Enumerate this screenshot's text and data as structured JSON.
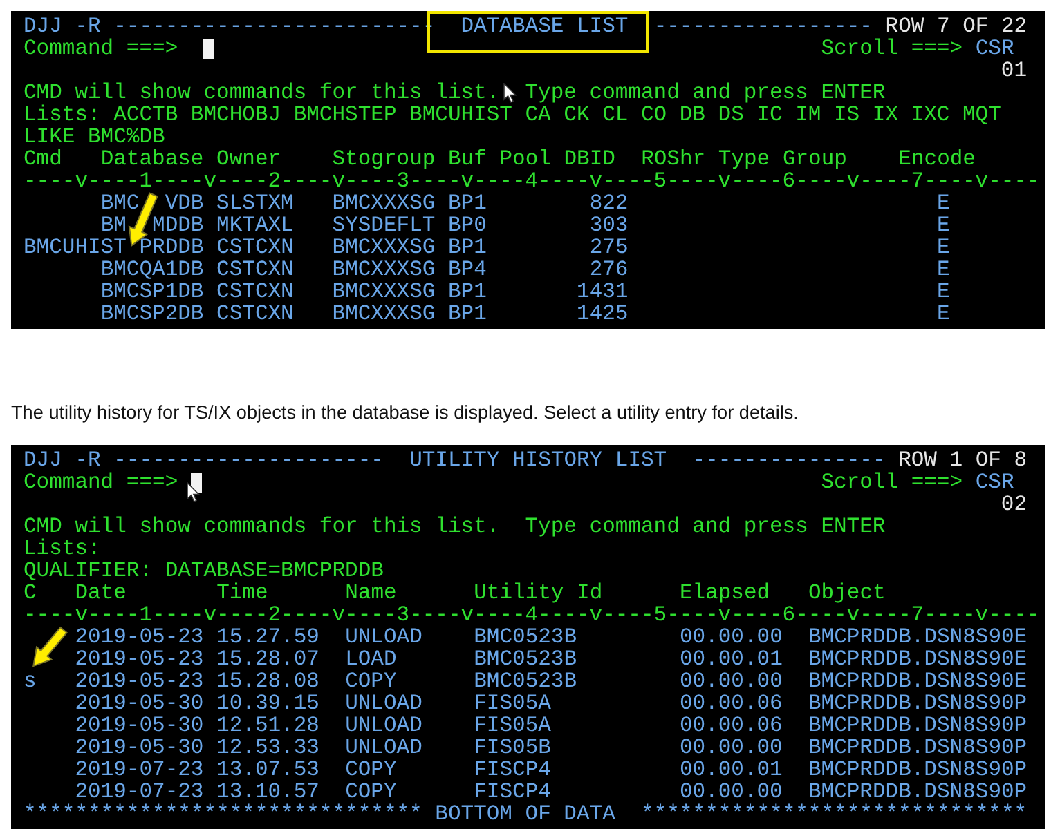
{
  "blocks": [
    {
      "kind": "terminal",
      "header_left": "DJJ -R",
      "header_rule_left": "-------------------------",
      "title": "DATABASE LIST",
      "title_highlighted": true,
      "header_rule_right": "-----------------",
      "row_info": "ROW 7 OF 22",
      "command_label": "Command ===>",
      "scroll_label": "Scroll ===>",
      "scroll_value": "CSR",
      "screen_number": "01",
      "info_line": "CMD will show commands for this list.  Type command and press ENTER",
      "lists_line": "Lists: ACCTB BMCHOBJ BMCHSTEP BMCUHIST CA CK CL CO DB DS IC IM IS IX IXC MQT",
      "extra_line": "LIKE BMC%DB",
      "columns": [
        "Cmd",
        "Database",
        "Owner",
        "Stogroup",
        "Buf Pool",
        "DBID",
        "ROShr",
        "Type",
        "Group",
        "Encode"
      ],
      "ruler": "----v----1----v----2----v----3----v----4----v----5----v----6----v----7----v----",
      "rows": [
        {
          "cells": [
            null,
            "BMC  VDB",
            "SLSTXM",
            "BMCXXXSG",
            "BP1",
            "822",
            null,
            null,
            null,
            "E"
          ]
        },
        {
          "cells": [
            null,
            "BM  MDDB",
            "MKTAXL",
            "SYSDEFLT",
            "BP0",
            "303",
            null,
            null,
            null,
            "E"
          ]
        },
        {
          "cells": [
            "BMCUHIST",
            "PRDDB",
            "CSTCXN",
            "BMCXXXSG",
            "BP1",
            "275",
            null,
            null,
            null,
            "E"
          ]
        },
        {
          "cells": [
            null,
            "BMCQA1DB",
            "CSTCXN",
            "BMCXXXSG",
            "BP4",
            "276",
            null,
            null,
            null,
            "E"
          ]
        },
        {
          "cells": [
            null,
            "BMCSP1DB",
            "CSTCXN",
            "BMCXXXSG",
            "BP1",
            "1431",
            null,
            null,
            null,
            "E"
          ]
        },
        {
          "cells": [
            null,
            "BMCSP2DB",
            "CSTCXN",
            "BMCXXXSG",
            "BP1",
            "1425",
            null,
            null,
            null,
            "E"
          ]
        }
      ],
      "arrow_annotation": true,
      "mouse_pointer": true
    },
    {
      "kind": "caption",
      "text": "The utility history for TS/IX objects in the database is displayed.  Select a utility entry for details."
    },
    {
      "kind": "terminal",
      "header_left": "DJJ -R",
      "header_rule_left": "---------------------",
      "title": "UTILITY HISTORY LIST",
      "title_highlighted": false,
      "header_rule_right": "---------------",
      "row_info": "ROW 1 OF 8",
      "command_label": "Command ===>",
      "scroll_label": "Scroll ===>",
      "scroll_value": "CSR",
      "screen_number": "02",
      "info_line": "CMD will show commands for this list.  Type command and press ENTER",
      "lists_line": "Lists:",
      "extra_line": "QUALIFIER: DATABASE=BMCPRDDB",
      "columns": [
        "C",
        "Date",
        "Time",
        "Name",
        "Utility Id",
        "Elapsed",
        "Object"
      ],
      "ruler": "----v----1----v----2----v----3----v----4----v----5----v----6----v----7----v----",
      "rows": [
        {
          "cells": [
            null,
            "2019-05-23",
            "15.27.59",
            "UNLOAD",
            "BMC0523B",
            "00.00.00",
            "BMCPRDDB.DSN8S90E"
          ]
        },
        {
          "cells": [
            null,
            "2019-05-23",
            "15.28.07",
            "LOAD",
            "BMC0523B",
            "00.00.01",
            "BMCPRDDB.DSN8S90E"
          ]
        },
        {
          "cells": [
            "s",
            "2019-05-23",
            "15.28.08",
            "COPY",
            "BMC0523B",
            "00.00.00",
            "BMCPRDDB.DSN8S90E"
          ]
        },
        {
          "cells": [
            null,
            "2019-05-30",
            "10.39.15",
            "UNLOAD",
            "FIS05A",
            "00.00.06",
            "BMCPRDDB.DSN8S90P"
          ]
        },
        {
          "cells": [
            null,
            "2019-05-30",
            "12.51.28",
            "UNLOAD",
            "FIS05A",
            "00.00.06",
            "BMCPRDDB.DSN8S90P"
          ]
        },
        {
          "cells": [
            null,
            "2019-05-30",
            "12.53.33",
            "UNLOAD",
            "FIS05B",
            "00.00.00",
            "BMCPRDDB.DSN8S90P"
          ]
        },
        {
          "cells": [
            null,
            "2019-07-23",
            "13.07.53",
            "COPY",
            "FISCP4",
            "00.00.01",
            "BMCPRDDB.DSN8S90P"
          ]
        },
        {
          "cells": [
            null,
            "2019-07-23",
            "13.10.57",
            "COPY",
            "FISCP4",
            "00.00.00",
            "BMCPRDDB.DSN8S90P"
          ]
        }
      ],
      "footer": {
        "left_rule": "*******************************",
        "text": "BOTTOM OF DATA",
        "right_rule": "******************************"
      },
      "arrow_annotation": true,
      "mouse_pointer": true
    }
  ]
}
